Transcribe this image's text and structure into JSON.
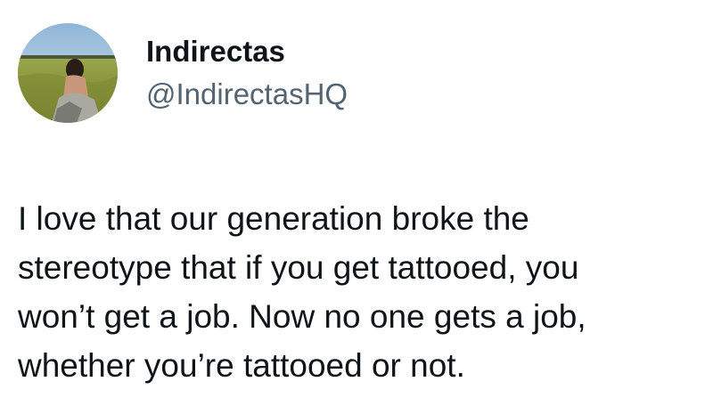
{
  "tweet": {
    "author": {
      "display_name": "Indirectas",
      "handle": "@IndirectasHQ",
      "avatar": "profile-photo-woman-in-wheat-field"
    },
    "text": "I love that our generation broke the\nstereotype that if you get tattooed, you\nwon’t get a job. Now no one gets a job,\nwhether you’re tattooed or not."
  }
}
